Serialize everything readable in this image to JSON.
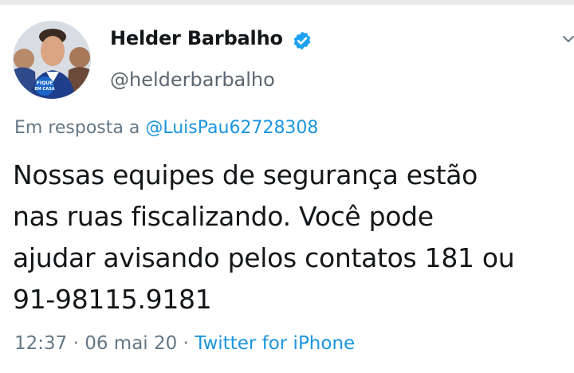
{
  "tweet": {
    "author": {
      "display_name": "Helder Barbalho",
      "handle": "@helderbarbalho",
      "verified": true,
      "avatar_badge_text": "FIQUE EM CASA"
    },
    "reply": {
      "prefix": "Em resposta a",
      "mention": "@LuisPau62728308"
    },
    "text_lines": [
      "Nossas equipes de segurança estão",
      "nas ruas fiscalizando. Você pode",
      "ajudar avisando pelos contatos 181 ou",
      "91-98115.9181"
    ],
    "meta": {
      "time": "12:37",
      "separator": " · ",
      "date": "06 mai 20",
      "source": "Twitter for iPhone"
    }
  },
  "colors": {
    "link": "#1b95e0",
    "secondary_text": "#657786",
    "verified_badge": "#1da1f2",
    "primary_text": "#14171a"
  },
  "icons": {
    "verified": "verified-badge-icon",
    "menu": "chevron-down-icon"
  }
}
